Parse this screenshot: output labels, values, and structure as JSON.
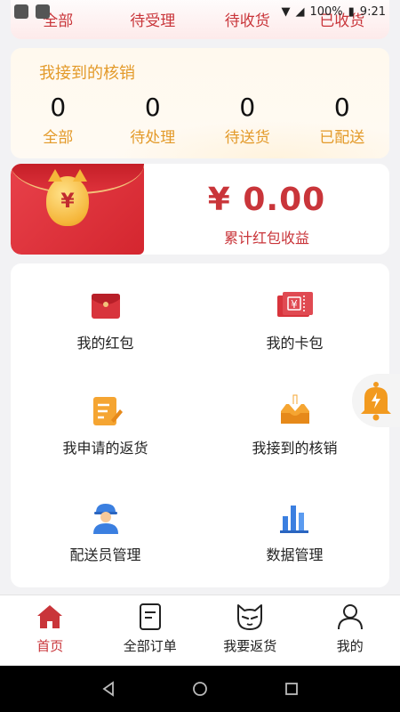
{
  "status_bar": {
    "battery": "100%",
    "time": "9:21"
  },
  "order_tabs": [
    "全部",
    "待受理",
    "待收货",
    "已收货"
  ],
  "verification": {
    "title": "我接到的核销",
    "stats": [
      {
        "value": "0",
        "label": "全部"
      },
      {
        "value": "0",
        "label": "待处理"
      },
      {
        "value": "0",
        "label": "待送货"
      },
      {
        "value": "0",
        "label": "已配送"
      }
    ]
  },
  "red_envelope": {
    "coin_symbol": "¥",
    "amount": "¥ 0.00",
    "label": "累计红包收益"
  },
  "menu": [
    {
      "label": "我的红包",
      "icon": "red-envelope-icon"
    },
    {
      "label": "我的卡包",
      "icon": "card-wallet-icon"
    },
    {
      "label": "我申请的返货",
      "icon": "return-request-icon"
    },
    {
      "label": "我接到的核销",
      "icon": "inbox-download-icon"
    },
    {
      "label": "配送员管理",
      "icon": "courier-icon"
    },
    {
      "label": "数据管理",
      "icon": "bar-chart-icon"
    }
  ],
  "bottom_nav": [
    {
      "label": "首页",
      "icon": "home-icon",
      "active": true
    },
    {
      "label": "全部订单",
      "icon": "order-list-icon",
      "active": false
    },
    {
      "label": "我要返货",
      "icon": "cat-face-icon",
      "active": false
    },
    {
      "label": "我的",
      "icon": "person-icon",
      "active": false
    }
  ],
  "colors": {
    "accent_red": "#c9353a",
    "accent_orange": "#e39a2a",
    "bell_orange": "#f29a1f"
  }
}
